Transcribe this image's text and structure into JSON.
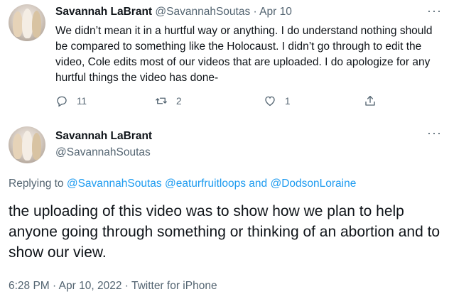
{
  "tweet1": {
    "author_name": "Savannah LaBrant",
    "handle": "@SavannahSoutas",
    "separator": "·",
    "date": "Apr 10",
    "more": "···",
    "text": "We didn’t mean it in a hurtful way or anything. I do understand nothing should be compared to something like the Holocaust. I didn’t go through to edit the video, Cole edits most of our videos that are uploaded. I do apologize for any hurtful things the video has done-",
    "actions": {
      "reply_count": "11",
      "retweet_count": "2",
      "like_count": "1"
    }
  },
  "tweet2": {
    "author_name": "Savannah LaBrant",
    "handle": "@SavannahSoutas",
    "more": "···",
    "replying_prefix": "Replying to",
    "replying_to": [
      "@SavannahSoutas",
      "@eaturfruitloops"
    ],
    "replying_and": "and",
    "replying_last": "@DodsonLoraine",
    "text": "the uploading of this video was to show how we plan to help anyone going through something or thinking of an abortion and to show our view.",
    "time": "6:28 PM",
    "separator": "·",
    "date": "Apr 10, 2022",
    "source": "Twitter for iPhone"
  },
  "colors": {
    "text": "#0f1419",
    "muted": "#536471",
    "link": "#1d9bf0"
  }
}
